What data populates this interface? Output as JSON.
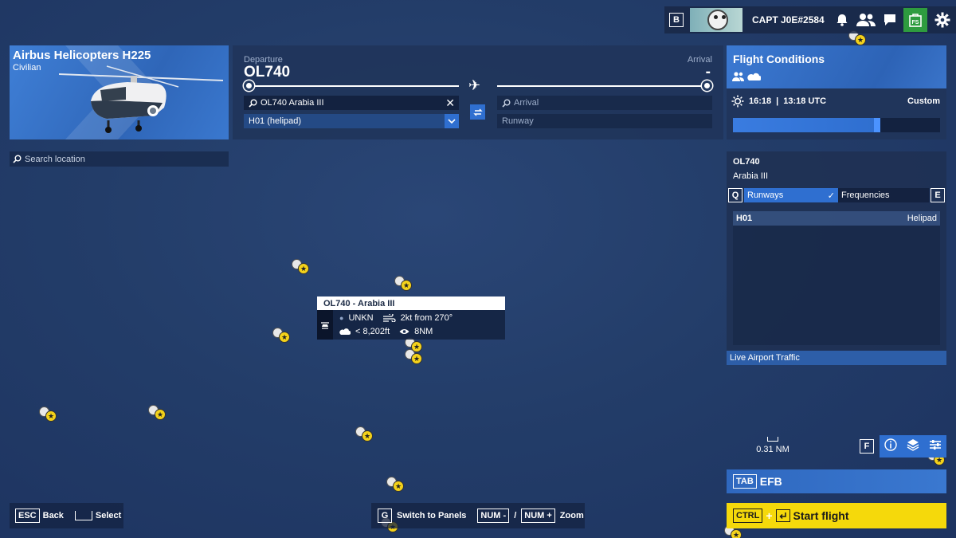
{
  "topbar": {
    "friends_key": "B",
    "username": "CAPT J0E#2584",
    "store_label": "FS"
  },
  "aircraft": {
    "name": "Airbus Helicopters H225",
    "category": "Civilian"
  },
  "search_location": {
    "placeholder": "Search location"
  },
  "route": {
    "departure_label": "Departure",
    "departure_code": "OL740",
    "arrival_label": "Arrival",
    "arrival_code": "-",
    "departure_airport_value": "OL740 Arabia III",
    "departure_parking": "H01 (helipad)",
    "arrival_placeholder": "Arrival",
    "arrival_runway_placeholder": "Runway"
  },
  "conditions": {
    "title": "Flight Conditions",
    "local_time": "16:18",
    "utc_time": "13:18 UTC",
    "preset": "Custom",
    "time_slider_value": 0.68
  },
  "airport_panel": {
    "code": "OL740",
    "name": "Arabia III",
    "tab_left_key": "Q",
    "tab_runways": "Runways",
    "tab_frequencies": "Frequencies",
    "tab_right_key": "E",
    "runway_id": "H01",
    "runway_type": "Helipad",
    "live_traffic": "Live Airport Traffic"
  },
  "map": {
    "scale": "0.31 NM",
    "filter_key": "F"
  },
  "tooltip": {
    "title": "OL740 - Arabia III",
    "metar": "UNKN",
    "wind": "2kt from 270°",
    "cloud": "< 8,202ft",
    "visibility": "8NM"
  },
  "actions": {
    "efb_key": "TAB",
    "efb_label": "EFB",
    "start_key": "CTRL",
    "start_plus": "+",
    "start_label": "Start flight"
  },
  "bottom": {
    "back_key": "ESC",
    "back_label": "Back",
    "select_label": "Select",
    "panels_key": "G",
    "panels_label": "Switch to Panels",
    "zoom_out_key": "NUM -",
    "zoom_sep": "/",
    "zoom_in_key": "NUM +",
    "zoom_label": "Zoom"
  },
  "colors": {
    "accent_blue": "#2f6fd0",
    "start_yellow": "#f5d90b",
    "map_bg": "#233d69"
  }
}
